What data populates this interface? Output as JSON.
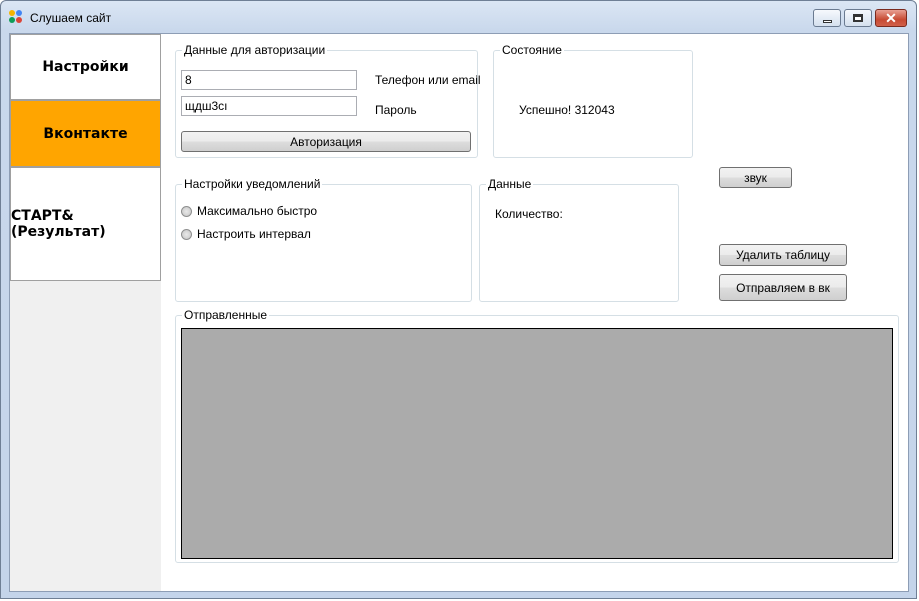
{
  "window": {
    "title": "Слушаем сайт",
    "icon": "app-icon",
    "controls": {
      "minimize": "minimize-icon",
      "maximize": "maximize-icon",
      "close": "close-icon"
    }
  },
  "tabs": [
    {
      "label": "Настройки",
      "selected": false
    },
    {
      "label": "Вконтакте",
      "selected": true
    },
    {
      "label": "СТАРТ&(Результат)",
      "selected": false
    }
  ],
  "auth": {
    "title": "Данные для авторизации",
    "phone_value": "8",
    "phone_label": "Телефон или email",
    "password_value": "щдш3сı",
    "password_label": "Пароль",
    "login_button": "Авторизация"
  },
  "status": {
    "title": "Состояние",
    "text": "Успешно! 312043"
  },
  "notifications": {
    "title": "Настройки уведомлений",
    "options": [
      "Максимально быстро",
      "Настроить интервал"
    ]
  },
  "data_group": {
    "title": "Данные",
    "count_label": "Количество:"
  },
  "buttons": {
    "sound": "звук",
    "delete_table": "Удалить таблицу",
    "send_vk": "Отправляем в вк"
  },
  "sent": {
    "title": "Отправленные"
  },
  "colors": {
    "selected_tab": "#ffa500",
    "grid_background": "#ababab"
  }
}
